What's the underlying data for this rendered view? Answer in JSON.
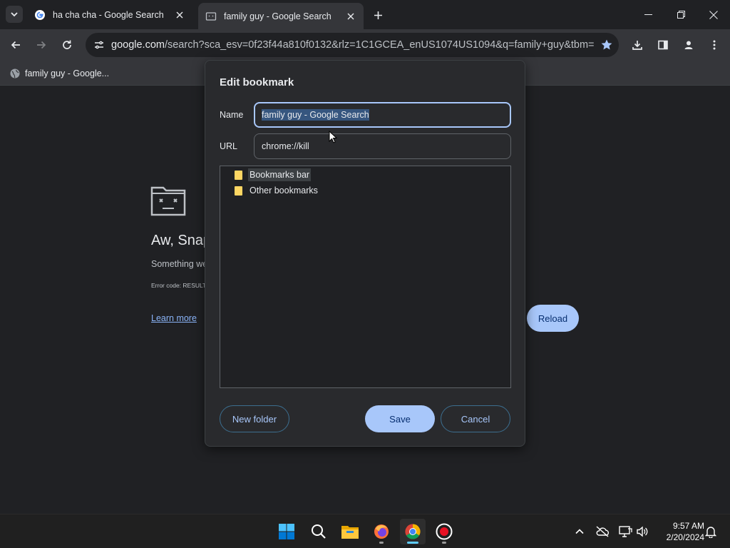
{
  "tabs": [
    {
      "title": "ha cha cha - Google Search",
      "active": false
    },
    {
      "title": "family guy - Google Search",
      "active": true
    }
  ],
  "omnibox": {
    "host": "google.com",
    "path": "/search?sca_esv=0f23f44a810f0132&rlz=1C1GCEA_enUS1074US1094&q=family+guy&tbm=isc..."
  },
  "bookmarks_bar": {
    "items": [
      {
        "label": "family guy - Google..."
      }
    ]
  },
  "error_page": {
    "title": "Aw, Snap",
    "message": "Something we",
    "code": "Error code: RESULT",
    "learn_more": "Learn more",
    "reload": "Reload"
  },
  "dialog": {
    "title": "Edit bookmark",
    "name_label": "Name",
    "name_value": "family guy - Google Search",
    "url_label": "URL",
    "url_value": "chrome://kill",
    "folders": [
      {
        "label": "Bookmarks bar",
        "selected": true
      },
      {
        "label": "Other bookmarks",
        "selected": false
      }
    ],
    "new_folder": "New folder",
    "save": "Save",
    "cancel": "Cancel"
  },
  "taskbar": {
    "time": "9:57 AM",
    "date": "2/20/2024"
  },
  "colors": {
    "accent": "#a8c7fa",
    "folder": "#fdd663",
    "background": "#202124"
  }
}
